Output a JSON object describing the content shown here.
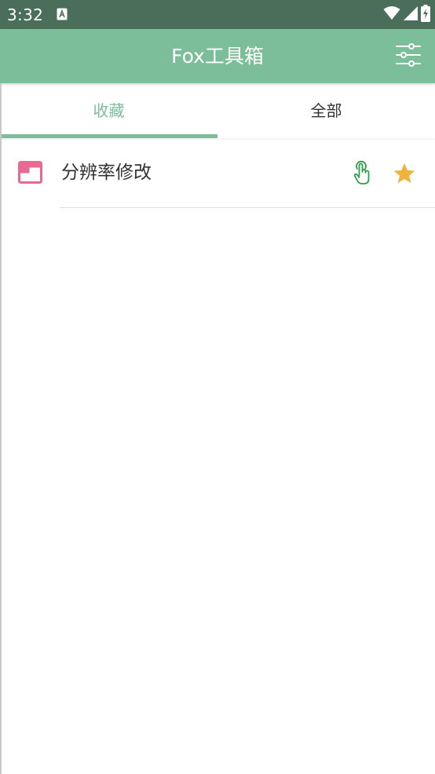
{
  "status_bar": {
    "time": "3:32",
    "icons": [
      "accessibility-a-icon",
      "wifi-icon",
      "signal-icon",
      "battery-charging-icon"
    ]
  },
  "app_bar": {
    "title": "Fox工具箱",
    "actions": [
      "filter-settings-icon"
    ]
  },
  "tabs": [
    {
      "label": "收藏",
      "selected": true
    },
    {
      "label": "全部",
      "selected": false
    }
  ],
  "list": {
    "items": [
      {
        "label": "分辨率修改",
        "icon": "window-icon",
        "actions": [
          "touch-icon",
          "star-icon"
        ],
        "favorited": true
      }
    ]
  },
  "colors": {
    "status_bar": "#4a6e59",
    "app_bar": "#7cbe99",
    "accent": "#7cbe99",
    "item_icon": "#e86a92",
    "touch_icon": "#2e9e4a",
    "star": "#f0b23a"
  }
}
